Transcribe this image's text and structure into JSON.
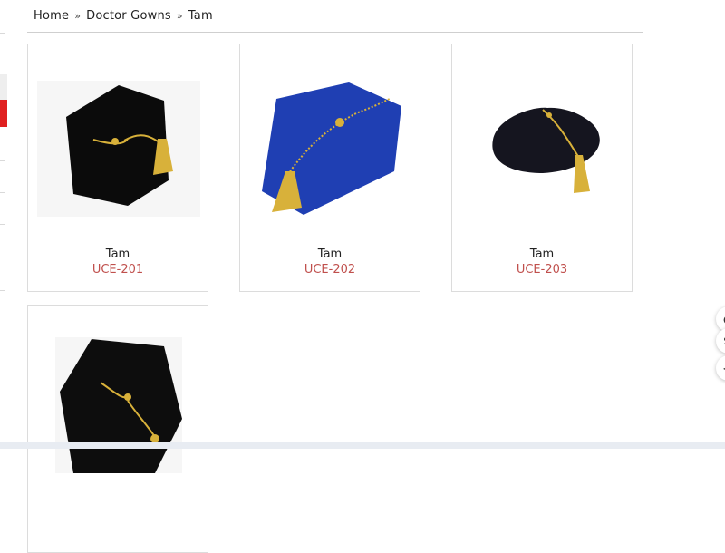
{
  "breadcrumb": {
    "home": "Home",
    "category": "Doctor Gowns",
    "current": "Tam"
  },
  "products": [
    {
      "title": "Tam",
      "code": "UCE-201",
      "color": "#111111",
      "style": "hexagon-black"
    },
    {
      "title": "Tam",
      "code": "UCE-202",
      "color": "#1f3fb3",
      "style": "hexagon-royal-blue"
    },
    {
      "title": "Tam",
      "code": "UCE-203",
      "color": "#15151f",
      "style": "bonnet-navy"
    },
    {
      "title": "",
      "code": "",
      "color": "#0d0d0d",
      "style": "hexagon-black"
    }
  ],
  "floating_actions": [
    "chat-icon",
    "share-icon",
    "back-icon"
  ],
  "colors": {
    "accent_red": "#e02020",
    "code_text": "#c0504d",
    "tassel_gold": "#d8b13a"
  }
}
